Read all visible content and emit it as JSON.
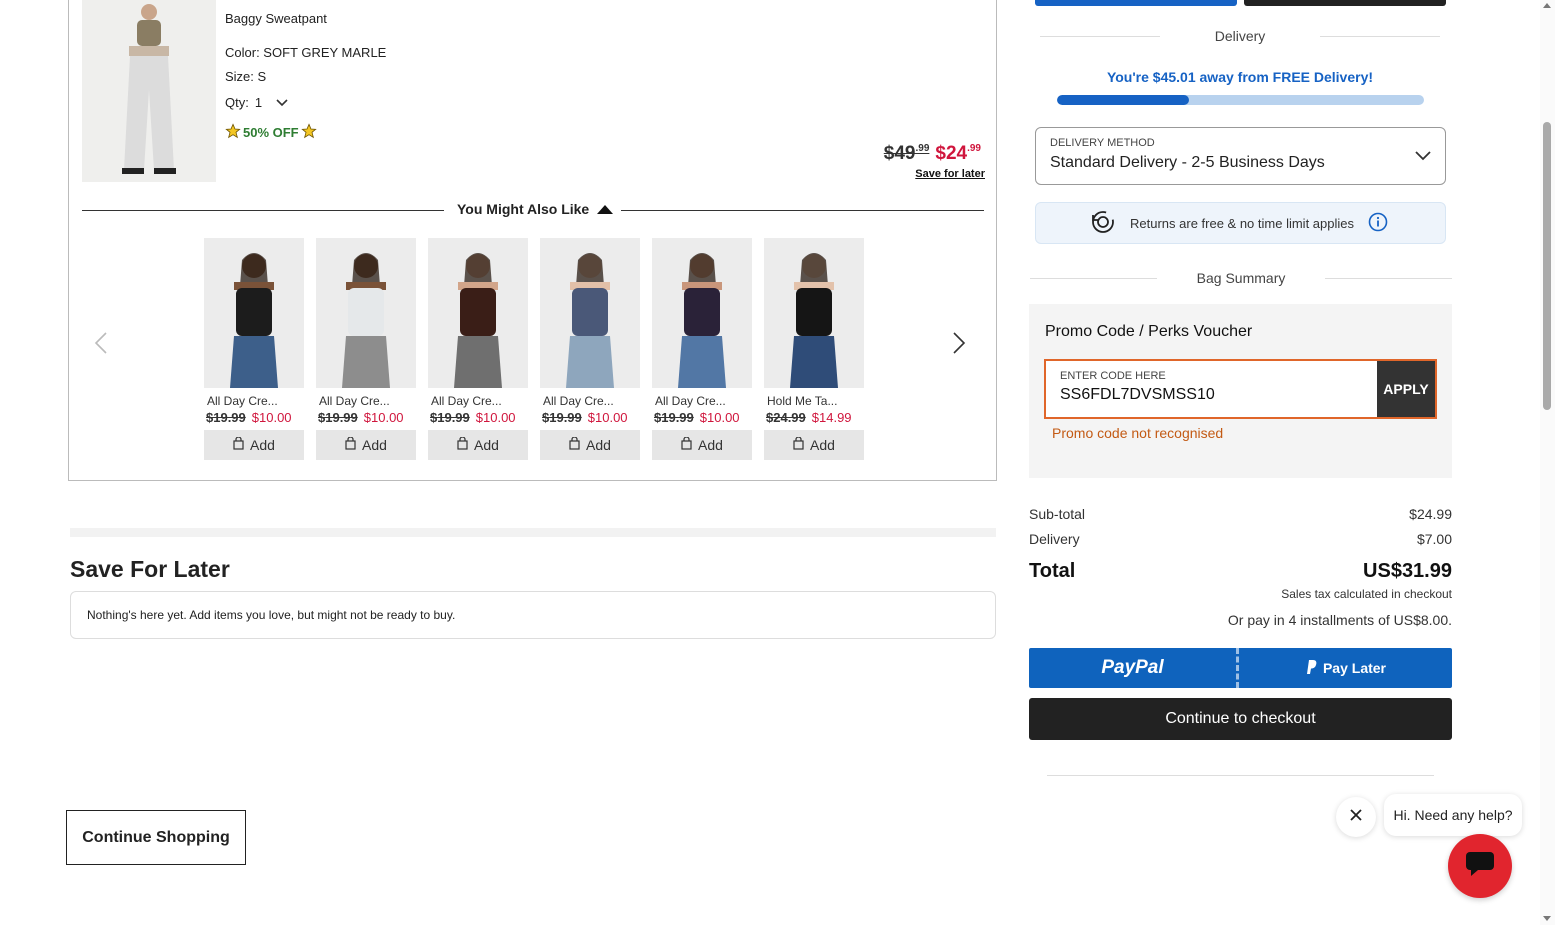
{
  "cart_item": {
    "name": "Baggy Sweatpant",
    "color": "Color: SOFT GREY MARLE",
    "size": "Size: S",
    "qty_label": "Qty:",
    "qty_value": "1",
    "badge": "50% OFF",
    "was_price_main": "$49",
    "was_price_cents": ".99",
    "now_price_main": "$24",
    "now_price_cents": ".99",
    "save_for_later": "Save for later"
  },
  "recommendations": {
    "title": "You Might Also Like",
    "items": [
      {
        "name": "All Day Cre...",
        "was": "$19.99",
        "now": "$10.00",
        "add": "Add",
        "top": "#1c1c1c",
        "bottom": "#3d5f8a",
        "skin": "#7a5238"
      },
      {
        "name": "All Day Cre...",
        "was": "$19.99",
        "now": "$10.00",
        "add": "Add",
        "top": "#e5e8ea",
        "bottom": "#8d8d8d",
        "skin": "#7a5238"
      },
      {
        "name": "All Day Cre...",
        "was": "$19.99",
        "now": "$10.00",
        "add": "Add",
        "top": "#3a1e17",
        "bottom": "#6f6f6f",
        "skin": "#d2a58a"
      },
      {
        "name": "All Day Cre...",
        "was": "$19.99",
        "now": "$10.00",
        "add": "Add",
        "top": "#4a5878",
        "bottom": "#8ea6bd",
        "skin": "#e2c0a8"
      },
      {
        "name": "All Day Cre...",
        "was": "$19.99",
        "now": "$10.00",
        "add": "Add",
        "top": "#2a2238",
        "bottom": "#5277a5",
        "skin": "#c9967b"
      },
      {
        "name": "Hold Me Ta...",
        "was": "$24.99",
        "now": "$14.99",
        "add": "Add",
        "top": "#151515",
        "bottom": "#2f4c78",
        "skin": "#e3c2ab"
      }
    ]
  },
  "save_for_later": {
    "title": "Save For Later",
    "empty_message": "Nothing's here yet. Add items you love, but might not be ready to buy."
  },
  "continue_shopping": "Continue Shopping",
  "delivery": {
    "heading": "Delivery",
    "free_message": "You're $45.01 away from FREE Delivery!",
    "progress_percent": 36,
    "method_label": "DELIVERY METHOD",
    "method_value": "Standard Delivery - 2-5 Business Days",
    "returns_text": "Returns are free & no time limit applies"
  },
  "bag_summary": {
    "heading": "Bag Summary",
    "promo_title": "Promo Code / Perks Voucher",
    "promo_label": "ENTER CODE HERE",
    "promo_value": "SS6FDL7DVSMSS10",
    "apply": "APPLY",
    "promo_error": "Promo code not recognised",
    "subtotal_label": "Sub-total",
    "subtotal_value": "$24.99",
    "delivery_label": "Delivery",
    "delivery_value": "$7.00",
    "total_label": "Total",
    "total_value": "US$31.99",
    "tax_note": "Sales tax calculated in checkout",
    "installments": "Or pay in 4 installments of US$8.00."
  },
  "payment": {
    "paypal": "PayPal",
    "pay_later": "Pay Later",
    "checkout": "Continue to checkout"
  },
  "chat": {
    "bubble": "Hi. Need any help?"
  },
  "colors": {
    "accent_blue": "#1662c4",
    "sale_red": "#d0163d",
    "error_orange": "#c35a14",
    "chat_red": "#e1252e"
  }
}
